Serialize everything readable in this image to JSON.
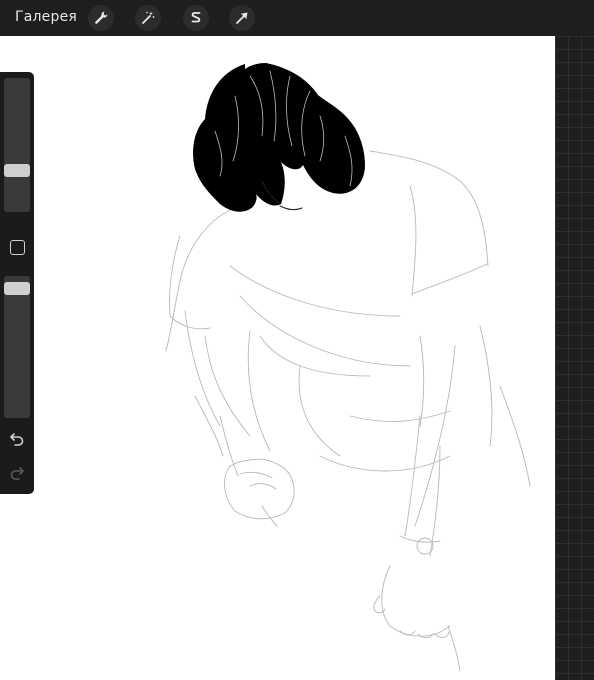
{
  "app": {
    "gallery_label": "Галерея"
  },
  "toolbar": {
    "tools": [
      {
        "name": "actions",
        "icon": "wrench-icon"
      },
      {
        "name": "adjustments",
        "icon": "magic-wand-icon"
      },
      {
        "name": "selection",
        "icon": "selection-s-icon"
      },
      {
        "name": "transform",
        "icon": "arrow-cursor-icon"
      }
    ]
  },
  "sidebar": {
    "brush_size": 0.29,
    "brush_opacity": 0.95,
    "undo_icon": "undo-icon",
    "redo_icon": "redo-icon",
    "modify_icon": "square-modify-icon"
  },
  "colors": {
    "toolbar_bg": "#1e1e1e",
    "canvas_bg": "#ffffff",
    "sidebar_bg": "#1b1b1d",
    "ink": "#000000"
  }
}
